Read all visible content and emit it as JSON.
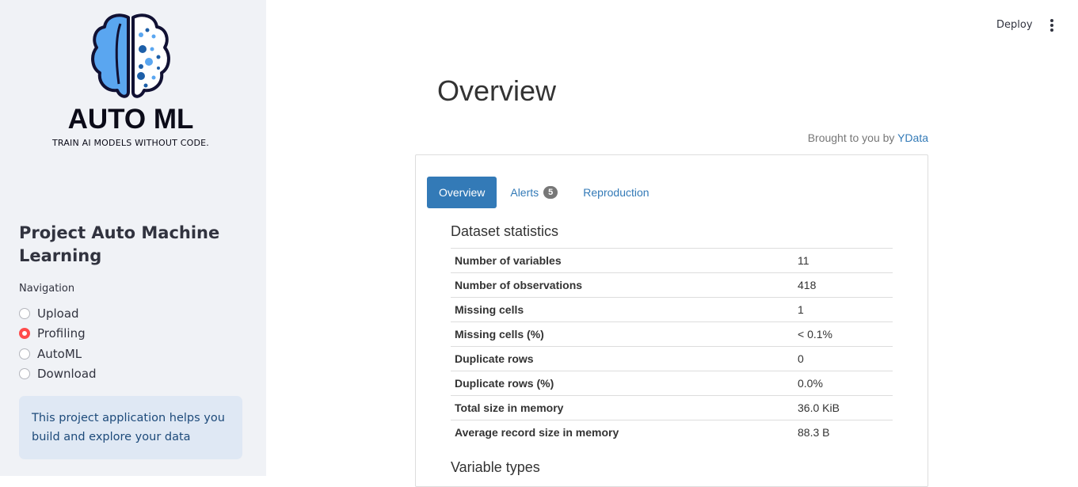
{
  "sidebar": {
    "logo_title": "AUTO ML",
    "logo_subtitle": "TRAIN AI MODELS WITHOUT CODE.",
    "title": "Project Auto Machine Learning",
    "nav_label": "Navigation",
    "nav_options": [
      {
        "label": "Upload",
        "checked": false
      },
      {
        "label": "Profiling",
        "checked": true
      },
      {
        "label": "AutoML",
        "checked": false
      },
      {
        "label": "Download",
        "checked": false
      }
    ],
    "info_text": "This project application helps you build and explore your data"
  },
  "header": {
    "deploy_label": "Deploy",
    "menu_icon": "more-vertical-icon"
  },
  "main": {
    "page_title": "Overview",
    "brought_by_prefix": "Brought to you by",
    "brought_by_link": "YData",
    "tabs": [
      {
        "label": "Overview",
        "active": true
      },
      {
        "label": "Alerts",
        "badge": "5",
        "active": false
      },
      {
        "label": "Reproduction",
        "active": false
      }
    ],
    "dataset_statistics_title": "Dataset statistics",
    "stats": [
      {
        "key": "Number of variables",
        "value": "11"
      },
      {
        "key": "Number of observations",
        "value": "418"
      },
      {
        "key": "Missing cells",
        "value": "1"
      },
      {
        "key": "Missing cells (%)",
        "value": "< 0.1%"
      },
      {
        "key": "Duplicate rows",
        "value": "0"
      },
      {
        "key": "Duplicate rows (%)",
        "value": "0.0%"
      },
      {
        "key": "Total size in memory",
        "value": "36.0 KiB"
      },
      {
        "key": "Average record size in memory",
        "value": "88.3 B"
      }
    ],
    "variable_types_title": "Variable types"
  },
  "colors": {
    "accent_radio": "#ff4b4b",
    "tab_active": "#337ab7",
    "sidebar_bg": "#f0f2f6",
    "info_bg": "#dfe8f4"
  }
}
